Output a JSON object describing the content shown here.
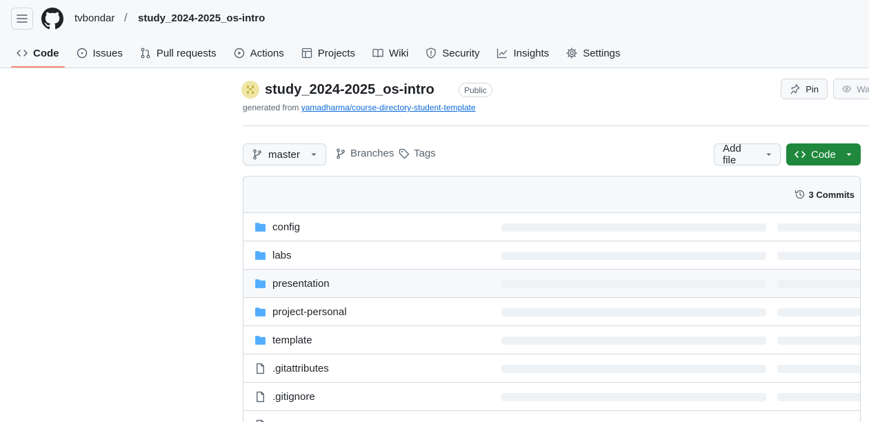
{
  "header": {
    "owner": "tvbondar",
    "separator": "/",
    "repo": "study_2024-2025_os-intro"
  },
  "tabs": [
    {
      "label": "Code",
      "icon": "code-icon",
      "active": true
    },
    {
      "label": "Issues",
      "icon": "issue-icon"
    },
    {
      "label": "Pull requests",
      "icon": "pull-request-icon"
    },
    {
      "label": "Actions",
      "icon": "play-icon"
    },
    {
      "label": "Projects",
      "icon": "table-icon"
    },
    {
      "label": "Wiki",
      "icon": "book-icon"
    },
    {
      "label": "Security",
      "icon": "shield-icon"
    },
    {
      "label": "Insights",
      "icon": "graph-icon"
    },
    {
      "label": "Settings",
      "icon": "gear-icon"
    }
  ],
  "repo": {
    "title": "study_2024-2025_os-intro",
    "visibility": "Public",
    "generated_from_prefix": "generated from",
    "template_link": "yamadharma/course-directory-student-template",
    "pin_label": "Pin",
    "watch_label": "Wat"
  },
  "toolbar": {
    "branch": "master",
    "branches_label": "Branches",
    "tags_label": "Tags",
    "add_file_label": "Add file",
    "code_label": "Code"
  },
  "files": {
    "commits_label": "3 Commits",
    "rows": [
      {
        "name": "config",
        "type": "folder"
      },
      {
        "name": "labs",
        "type": "folder"
      },
      {
        "name": "presentation",
        "type": "folder"
      },
      {
        "name": "project-personal",
        "type": "folder"
      },
      {
        "name": "template",
        "type": "folder"
      },
      {
        "name": ".gitattributes",
        "type": "file"
      },
      {
        "name": ".gitignore",
        "type": "file"
      }
    ]
  },
  "colors": {
    "accent_tab": "#fd8c73",
    "code_button": "#1f883d",
    "folder": "#54aeff",
    "link": "#0969da"
  }
}
